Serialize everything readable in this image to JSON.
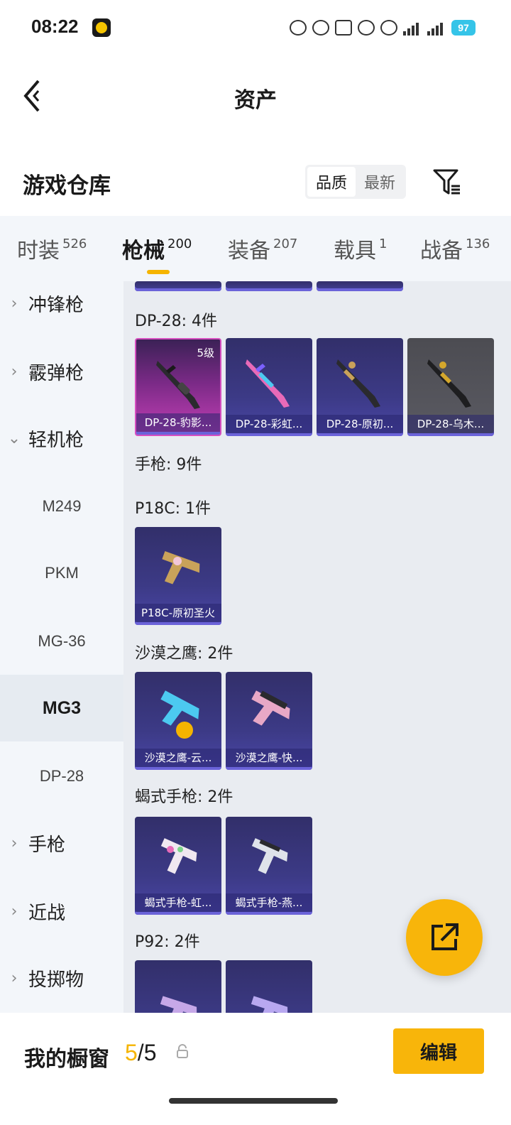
{
  "status_bar": {
    "time": "08:22",
    "battery": "97",
    "network": [
      "5G",
      "5G"
    ],
    "icons": [
      "alarm-icon",
      "mute-icon",
      "cat-icon",
      "wifi-icon",
      "paw-icon"
    ]
  },
  "header": {
    "title": "资产",
    "back_icon": "chevron-left-icon"
  },
  "warehouse": {
    "title": "游戏仓库",
    "sort_options": [
      "品质",
      "最新"
    ],
    "active_sort": "品质",
    "filter_icon": "filter-icon"
  },
  "tabs": [
    {
      "label": "时装",
      "count": "526"
    },
    {
      "label": "枪械",
      "count": "200"
    },
    {
      "label": "装备",
      "count": "207"
    },
    {
      "label": "载具",
      "count": "1"
    },
    {
      "label": "战备",
      "count": "136"
    }
  ],
  "active_tab": "枪械",
  "sidebar": [
    {
      "label": "冲锋枪",
      "expandable": true
    },
    {
      "label": "霰弹枪",
      "expandable": true
    },
    {
      "label": "轻机枪",
      "expanded": true
    },
    {
      "label": "M249",
      "sub": true
    },
    {
      "label": "PKM",
      "sub": true
    },
    {
      "label": "MG-36",
      "sub": true
    },
    {
      "label": "MG3",
      "sub": true,
      "selected": true
    },
    {
      "label": "DP-28",
      "sub": true
    },
    {
      "label": "手枪",
      "expandable": true
    },
    {
      "label": "近战",
      "expandable": true
    },
    {
      "label": "投掷物",
      "expandable": true
    }
  ],
  "content": {
    "sections": [
      {
        "label": "DP-28: 4件",
        "items": [
          {
            "name": "DP-28-豹影...",
            "level": "5级",
            "rarity": "pink"
          },
          {
            "name": "DP-28-彩虹...",
            "rarity": "purple"
          },
          {
            "name": "DP-28-原初...",
            "rarity": "purple"
          },
          {
            "name": "DP-28-乌木...",
            "rarity": "grey"
          }
        ]
      },
      {
        "label": "手枪: 9件"
      },
      {
        "label": "P18C: 1件",
        "items": [
          {
            "name": "P18C-原初圣火",
            "rarity": "purple"
          }
        ]
      },
      {
        "label": "沙漠之鹰: 2件",
        "items": [
          {
            "name": "沙漠之鹰-云...",
            "rarity": "purple"
          },
          {
            "name": "沙漠之鹰-快...",
            "rarity": "purple"
          }
        ]
      },
      {
        "label": "蝎式手枪: 2件",
        "items": [
          {
            "name": "蝎式手枪-虹...",
            "rarity": "purple"
          },
          {
            "name": "蝎式手枪-燕...",
            "rarity": "purple"
          }
        ]
      },
      {
        "label": "P92: 2件",
        "items": [
          {
            "name": ""
          },
          {
            "name": ""
          }
        ]
      }
    ]
  },
  "fab": {
    "icon": "share-external-icon"
  },
  "bottom_bar": {
    "label": "我的橱窗",
    "current": "5",
    "total": "5",
    "separator": "/",
    "lock_icon": "lock-icon",
    "edit_label": "编辑"
  },
  "colors": {
    "accent": "#f8b50a",
    "card_purple": "#3c3a86",
    "card_pink": "#c23fb5",
    "card_grey": "#5a5a62"
  }
}
